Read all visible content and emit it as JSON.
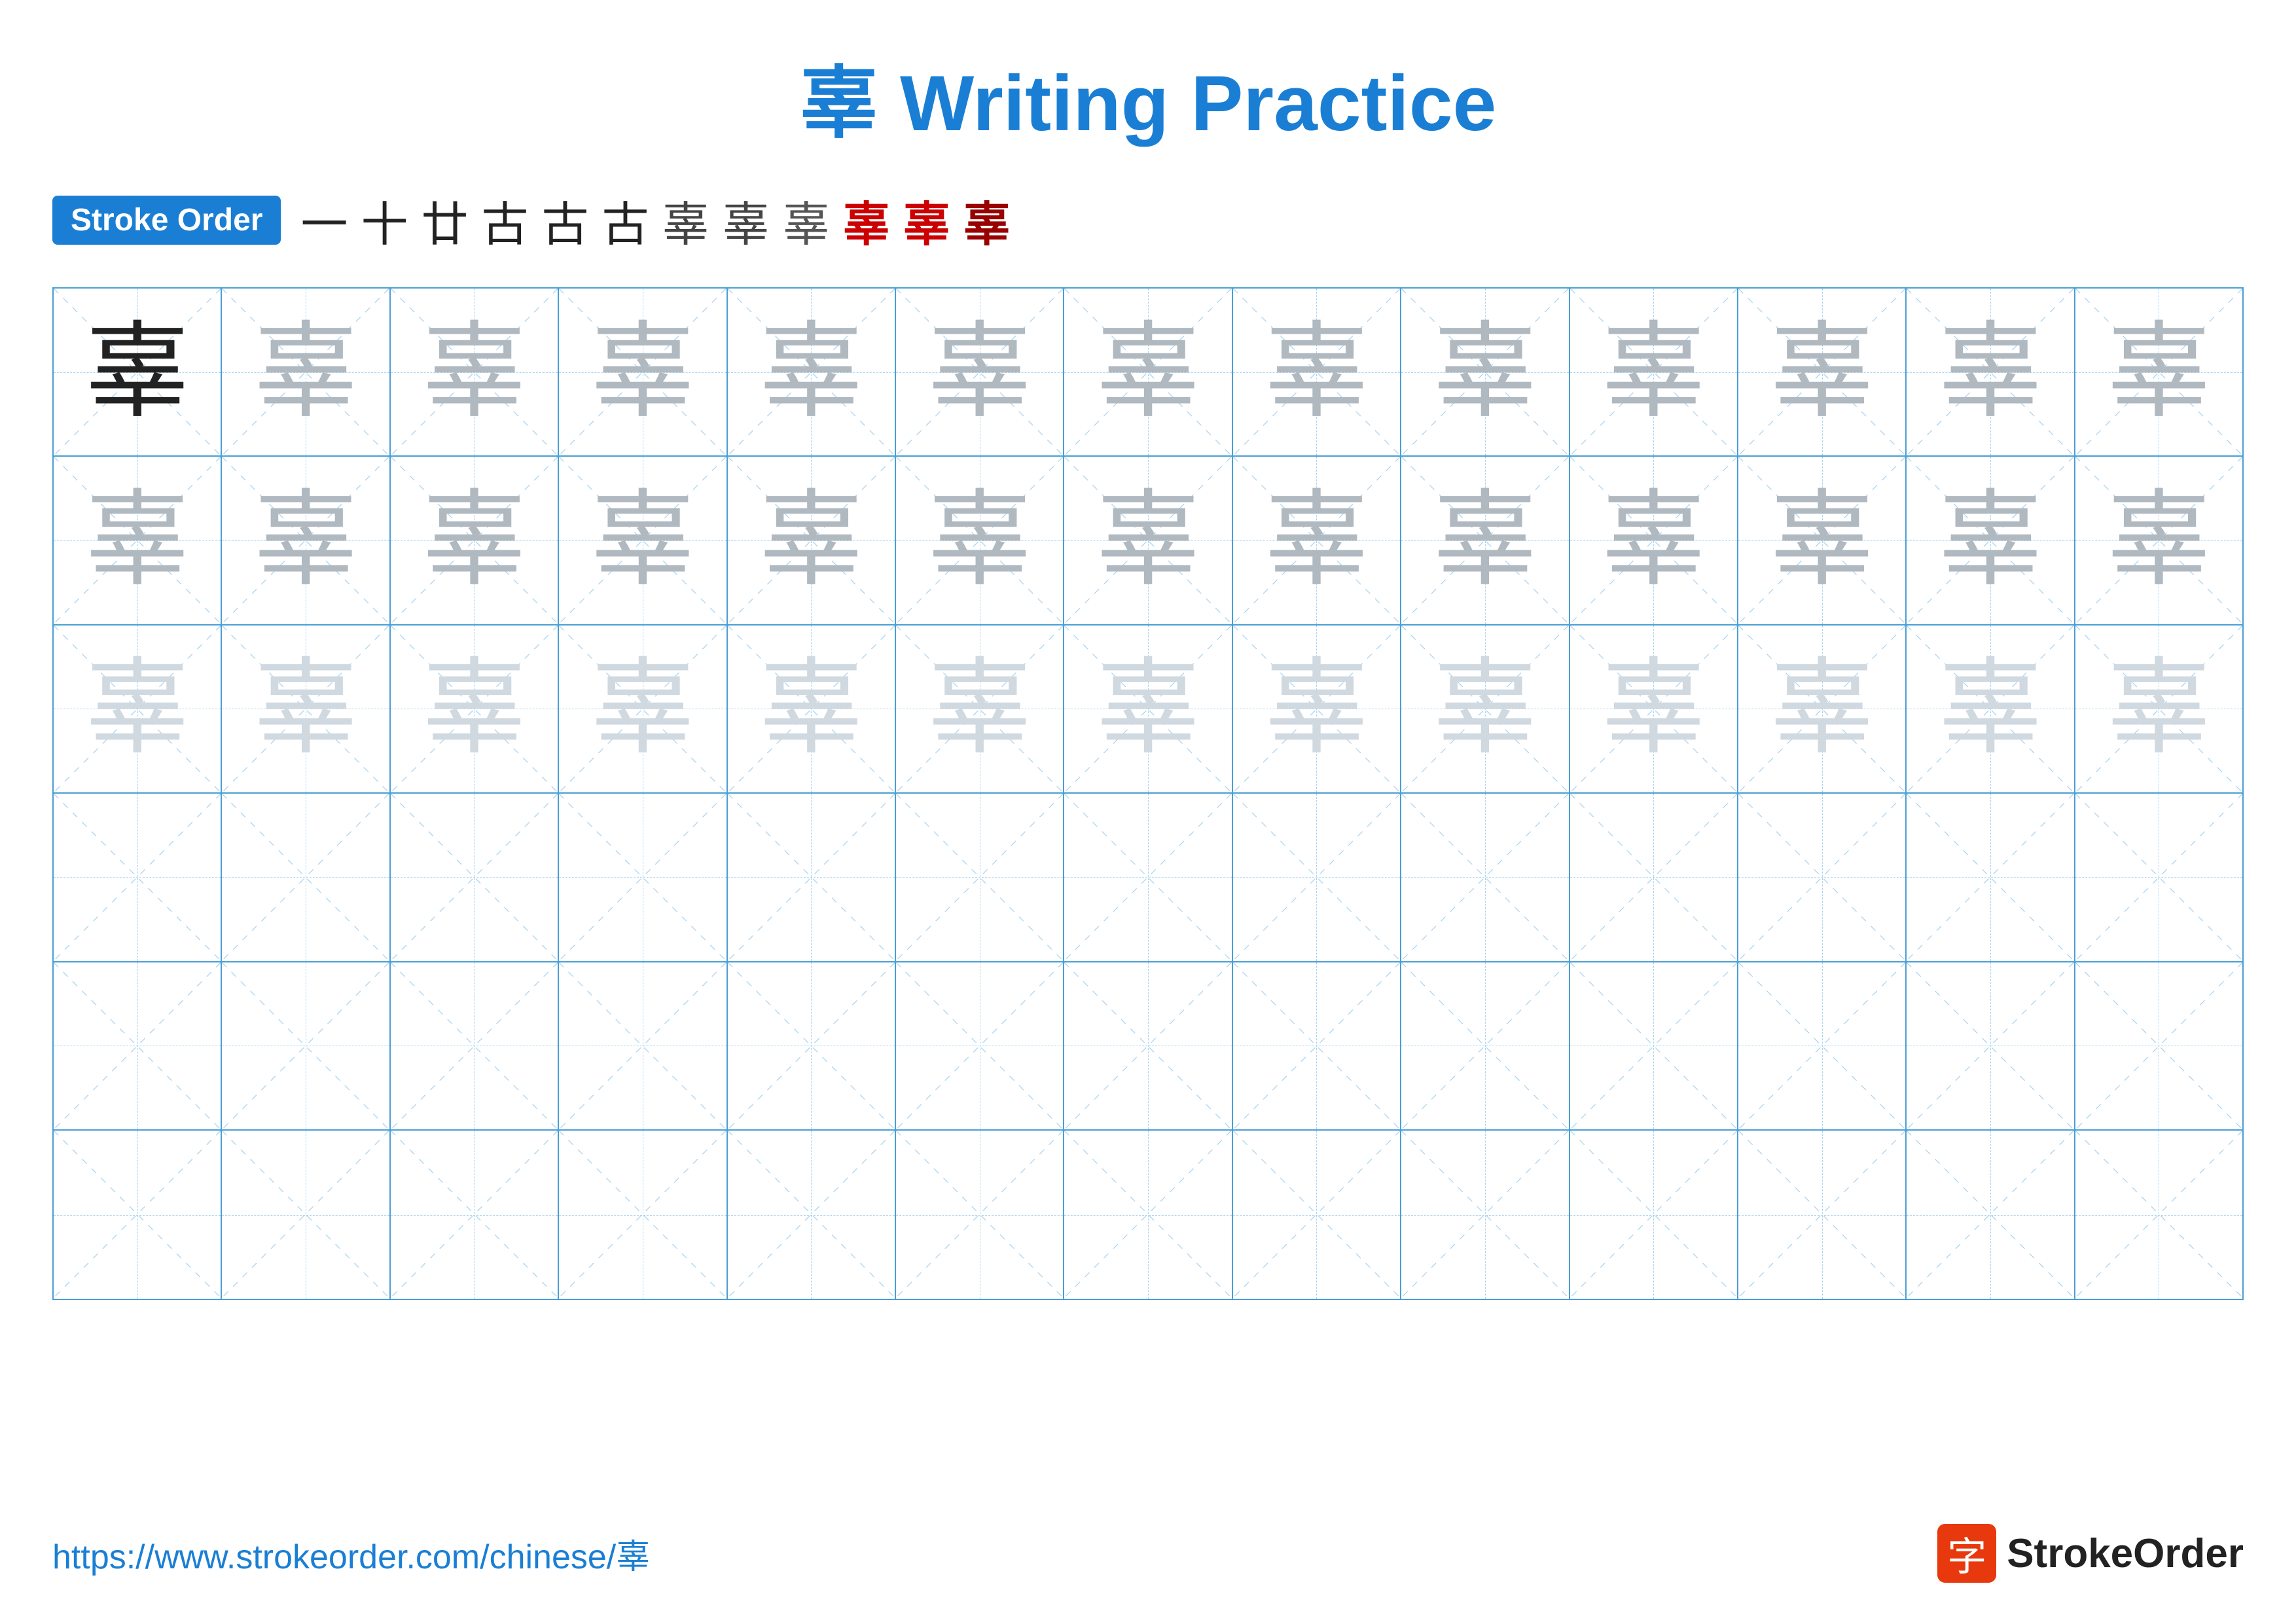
{
  "title": {
    "char": "辜",
    "text": " Writing Practice"
  },
  "stroke_order": {
    "badge_label": "Stroke Order",
    "strokes": [
      {
        "char": "一",
        "style": "normal"
      },
      {
        "char": "十",
        "style": "normal"
      },
      {
        "char": "廿",
        "style": "normal"
      },
      {
        "char": "古",
        "style": "normal"
      },
      {
        "char": "古",
        "style": "normal"
      },
      {
        "char": "古",
        "style": "normal"
      },
      {
        "char": "辜",
        "style": "partial1"
      },
      {
        "char": "辜",
        "style": "partial2"
      },
      {
        "char": "辜",
        "style": "partial3"
      },
      {
        "char": "辜",
        "style": "red"
      },
      {
        "char": "辜",
        "style": "red"
      },
      {
        "char": "辜",
        "style": "dark-red"
      }
    ]
  },
  "grid": {
    "rows": 6,
    "cols": 13,
    "practice_char": "辜",
    "row_data": [
      [
        {
          "opacity": "dark"
        },
        {
          "opacity": "medium"
        },
        {
          "opacity": "medium"
        },
        {
          "opacity": "medium"
        },
        {
          "opacity": "medium"
        },
        {
          "opacity": "medium"
        },
        {
          "opacity": "medium"
        },
        {
          "opacity": "medium"
        },
        {
          "opacity": "medium"
        },
        {
          "opacity": "medium"
        },
        {
          "opacity": "medium"
        },
        {
          "opacity": "medium"
        },
        {
          "opacity": "medium"
        }
      ],
      [
        {
          "opacity": "medium"
        },
        {
          "opacity": "medium"
        },
        {
          "opacity": "medium"
        },
        {
          "opacity": "medium"
        },
        {
          "opacity": "medium"
        },
        {
          "opacity": "medium"
        },
        {
          "opacity": "medium"
        },
        {
          "opacity": "medium"
        },
        {
          "opacity": "medium"
        },
        {
          "opacity": "medium"
        },
        {
          "opacity": "medium"
        },
        {
          "opacity": "medium"
        },
        {
          "opacity": "medium"
        }
      ],
      [
        {
          "opacity": "light"
        },
        {
          "opacity": "light"
        },
        {
          "opacity": "light"
        },
        {
          "opacity": "light"
        },
        {
          "opacity": "light"
        },
        {
          "opacity": "light"
        },
        {
          "opacity": "light"
        },
        {
          "opacity": "light"
        },
        {
          "opacity": "light"
        },
        {
          "opacity": "light"
        },
        {
          "opacity": "light"
        },
        {
          "opacity": "light"
        },
        {
          "opacity": "light"
        }
      ],
      [
        {
          "opacity": "empty"
        },
        {
          "opacity": "empty"
        },
        {
          "opacity": "empty"
        },
        {
          "opacity": "empty"
        },
        {
          "opacity": "empty"
        },
        {
          "opacity": "empty"
        },
        {
          "opacity": "empty"
        },
        {
          "opacity": "empty"
        },
        {
          "opacity": "empty"
        },
        {
          "opacity": "empty"
        },
        {
          "opacity": "empty"
        },
        {
          "opacity": "empty"
        },
        {
          "opacity": "empty"
        }
      ],
      [
        {
          "opacity": "empty"
        },
        {
          "opacity": "empty"
        },
        {
          "opacity": "empty"
        },
        {
          "opacity": "empty"
        },
        {
          "opacity": "empty"
        },
        {
          "opacity": "empty"
        },
        {
          "opacity": "empty"
        },
        {
          "opacity": "empty"
        },
        {
          "opacity": "empty"
        },
        {
          "opacity": "empty"
        },
        {
          "opacity": "empty"
        },
        {
          "opacity": "empty"
        },
        {
          "opacity": "empty"
        }
      ],
      [
        {
          "opacity": "empty"
        },
        {
          "opacity": "empty"
        },
        {
          "opacity": "empty"
        },
        {
          "opacity": "empty"
        },
        {
          "opacity": "empty"
        },
        {
          "opacity": "empty"
        },
        {
          "opacity": "empty"
        },
        {
          "opacity": "empty"
        },
        {
          "opacity": "empty"
        },
        {
          "opacity": "empty"
        },
        {
          "opacity": "empty"
        },
        {
          "opacity": "empty"
        },
        {
          "opacity": "empty"
        }
      ]
    ]
  },
  "footer": {
    "url": "https://www.strokeorder.com/chinese/辜",
    "logo_char": "字",
    "logo_text": "StrokeOrder"
  }
}
